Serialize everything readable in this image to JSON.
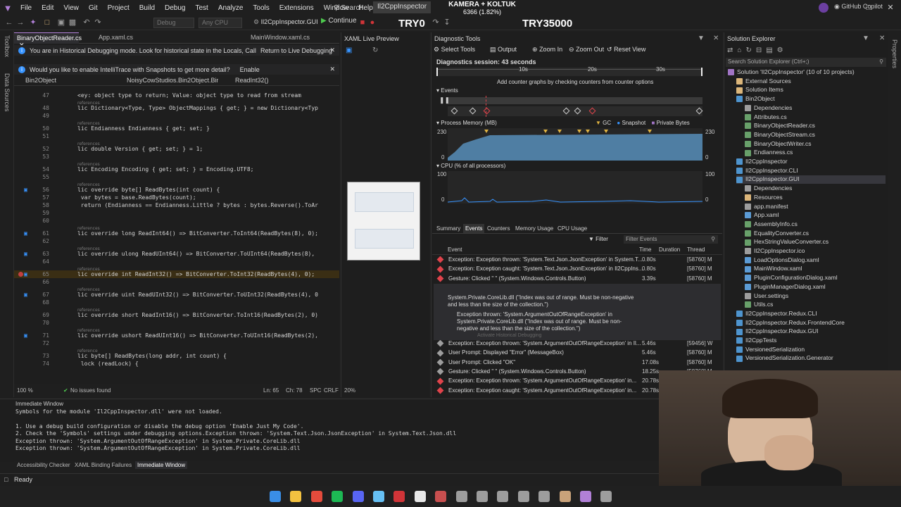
{
  "menu": {
    "items": [
      "File",
      "Edit",
      "View",
      "Git",
      "Project",
      "Build",
      "Debug",
      "Test",
      "Analyze",
      "Tools",
      "Extensions",
      "Window",
      "Help"
    ],
    "search": "Search",
    "app_name": "Il2CppInspector",
    "overlay_line1": "KAMERA + KOLTUK",
    "overlay_line2": "6366 (1.82%)",
    "github": "GitHub Copilot"
  },
  "toolbar": {
    "config": "Debug",
    "platform": "Any CPU",
    "startup": "Il2CppInspector.GUI",
    "continue": "Continue",
    "overlay_left": "TRY0",
    "overlay_right": "TRY35000"
  },
  "left_strip": [
    "Toolbox",
    "Data Sources"
  ],
  "editor": {
    "tabs": [
      "BinaryObjectReader.cs",
      "App.xaml.cs",
      "MainWindow.xaml.cs"
    ],
    "info1": "You are in Historical Debugging mode. Look for historical state in the Locals, Call Stack and other debugging windows.",
    "info1_link": "Return to Live Debugging",
    "info2": "Would you like to enable IntelliTrace with Snapshots to get more detail?",
    "info2_link": "Enable",
    "nav_project": "Bin2Object",
    "nav_class": "NoisyCowStudios.Bin2Object.Binar",
    "nav_member": "ReadInt32()",
    "lines": [
      {
        "ref": true,
        "text": ""
      },
      {
        "n": "47",
        "text": "<ey: object type to return; Value: object type to read from stream",
        "cls": "cm"
      },
      {
        "ref": true,
        "text": "references"
      },
      {
        "n": "48",
        "text": "lic Dictionary<Type, Type> ObjectMappings { get; } = new Dictionary<Typ"
      },
      {
        "n": "49",
        "text": ""
      },
      {
        "ref": true,
        "text": "references"
      },
      {
        "n": "50",
        "text": "lic Endianness Endianness { get; set; }"
      },
      {
        "n": "51",
        "text": ""
      },
      {
        "ref": true,
        "text": "references"
      },
      {
        "n": "52",
        "text": "lic double Version { get; set; } = 1;"
      },
      {
        "n": "53",
        "text": ""
      },
      {
        "ref": true,
        "text": "references"
      },
      {
        "n": "54",
        "text": "lic Encoding Encoding { get; set; } = Encoding.UTF8;"
      },
      {
        "n": "55",
        "text": ""
      },
      {
        "ref": true,
        "text": "references"
      },
      {
        "n": "56",
        "text": "lic override byte[] ReadBytes(int count) {"
      },
      {
        "n": "57",
        "text": " var bytes = base.ReadBytes(count);"
      },
      {
        "n": "58",
        "text": " return (Endianness == Endianness.Little ? bytes : bytes.Reverse().ToAr"
      },
      {
        "n": "59",
        "text": ""
      },
      {
        "n": "60",
        "text": ""
      },
      {
        "ref": true,
        "text": "references"
      },
      {
        "n": "61",
        "text": "lic override long ReadInt64() => BitConverter.ToInt64(ReadBytes(8), 0);"
      },
      {
        "n": "62",
        "text": ""
      },
      {
        "ref": true,
        "text": "references"
      },
      {
        "n": "63",
        "text": "lic override ulong ReadUInt64() => BitConverter.ToUInt64(ReadBytes(8),"
      },
      {
        "n": "64",
        "text": ""
      },
      {
        "ref": true,
        "text": "references"
      },
      {
        "n": "65",
        "text": "lic override int ReadInt32() => BitConverter.ToInt32(ReadBytes(4), 0);",
        "hl": true
      },
      {
        "n": "66",
        "text": ""
      },
      {
        "ref": true,
        "text": "references"
      },
      {
        "n": "67",
        "text": "lic override uint ReadUInt32() => BitConverter.ToUInt32(ReadBytes(4), 0"
      },
      {
        "n": "68",
        "text": ""
      },
      {
        "ref": true,
        "text": "references"
      },
      {
        "n": "69",
        "text": "lic override short ReadInt16() => BitConverter.ToInt16(ReadBytes(2), 0)"
      },
      {
        "n": "70",
        "text": ""
      },
      {
        "ref": true,
        "text": "references"
      },
      {
        "n": "71",
        "text": "lic override ushort ReadUInt16() => BitConverter.ToUInt16(ReadBytes(2),"
      },
      {
        "n": "72",
        "text": ""
      },
      {
        "ref": true,
        "text": "reference"
      },
      {
        "n": "73",
        "text": "lic byte[] ReadBytes(long addr, int count) {"
      },
      {
        "n": "74",
        "text": " lock (readLock) {"
      }
    ],
    "zoom": "100 %",
    "issues": "No issues found",
    "ln": "Ln: 65",
    "ch": "Ch: 78",
    "spc": "SPC",
    "crlf": "CRLF"
  },
  "xaml": {
    "title": "XAML Live Preview",
    "zoom": "20%"
  },
  "diag": {
    "title": "Diagnostic Tools",
    "select_tools": "Select Tools",
    "output": "Output",
    "zoom_in": "Zoom In",
    "zoom_out": "Zoom Out",
    "reset_view": "Reset View",
    "session": "Diagnostics session: 43 seconds",
    "ticks": [
      "10s",
      "20s",
      "30s"
    ],
    "add_counter": "Add counter graphs by checking counters from counter options",
    "events_label": "Events",
    "memory_label": "Process Memory (MB)",
    "gc": "GC",
    "snapshot": "Snapshot",
    "private_bytes": "Private Bytes",
    "mem_max": "230",
    "mem_min": "0",
    "cpu_label": "CPU (% of all processors)",
    "cpu_max": "100",
    "cpu_min": "0",
    "tabs": [
      "Summary",
      "Events",
      "Counters",
      "Memory Usage",
      "CPU Usage"
    ],
    "filter": "Filter",
    "filter_events": "Filter Events",
    "col_event": "Event",
    "col_time": "Time",
    "col_duration": "Duration",
    "col_thread": "Thread",
    "events": [
      {
        "text": "Exception: Exception thrown: 'System.Text.Json.JsonException' in System.T...",
        "time": "0.80s",
        "thread": "[58760] M",
        "color": "#e0434b"
      },
      {
        "text": "Exception: Exception caught: 'System.Text.Json.JsonException' in Il2CppIns...",
        "time": "0.80s",
        "thread": "[58760] M",
        "color": "#e0434b"
      },
      {
        "text": "Gesture: Clicked \"    \" (System.Windows.Controls.Button)",
        "time": "3.39s",
        "thread": "[58760] M",
        "color": "#e0434b"
      },
      {
        "text": "Exception: Exception thrown: 'System.ArgumentOutOfRangeException' in",
        "time": "5.46s",
        "thread": "[59456] W",
        "color": "#e0434b"
      }
    ],
    "selected_detail1": "System.Private.CoreLib.dll (\"Index was out of range. Must be non-negative",
    "selected_detail2": "and less than the size of the collection.\")",
    "detail_a": "Exception thrown: 'System.ArgumentOutOfRangeException' in",
    "detail_b": "System.Private.CoreLib.dll (\"Index was out of range. Must be non-",
    "detail_c": "negative and less than the size of the collection.\")",
    "detail_d": "Activate Historical Debugging",
    "events2": [
      {
        "text": "Exception: Exception thrown: 'System.ArgumentOutOfRangeException' in Il...",
        "time": "5.46s",
        "thread": "[59456] W",
        "color": "#9d9d9d"
      },
      {
        "text": "User Prompt: Displayed \"Error\" (MessageBox)",
        "time": "5.46s",
        "thread": "[58760] M",
        "color": "#9d9d9d"
      },
      {
        "text": "User Prompt: Clicked \"OK\"",
        "time": "17.08s",
        "thread": "[58760] M",
        "color": "#9d9d9d"
      },
      {
        "text": "Gesture: Clicked \"    \" (System.Windows.Controls.Button)",
        "time": "18.25s",
        "thread": "[58760] M",
        "color": "#9d9d9d"
      },
      {
        "text": "Exception: Exception thrown: 'System.ArgumentOutOfRangeException' in...",
        "time": "20.78s",
        "thread": "[58760] M",
        "color": "#e0434b"
      },
      {
        "text": "Exception: Exception caught: 'System.ArgumentOutOfRangeException' in...",
        "time": "20.78s",
        "thread": "[58760] M",
        "color": "#e0434b"
      }
    ]
  },
  "solution": {
    "title": "Solution Explorer",
    "search": "Search Solution Explorer (Ctrl+;)",
    "items": [
      {
        "label": "Solution 'Il2CppInspector' (10 of 10 projects)",
        "indent": 0,
        "color": "#a074c4"
      },
      {
        "label": "External Sources",
        "indent": 1,
        "color": "#dcb67a"
      },
      {
        "label": "Solution Items",
        "indent": 1,
        "color": "#dcb67a"
      },
      {
        "label": "Bin2Object",
        "indent": 1,
        "color": "#4e94ce"
      },
      {
        "label": "Dependencies",
        "indent": 2,
        "color": "#9d9d9d"
      },
      {
        "label": "Attributes.cs",
        "indent": 2,
        "color": "#68a06a"
      },
      {
        "label": "BinaryObjectReader.cs",
        "indent": 2,
        "color": "#68a06a"
      },
      {
        "label": "BinaryObjectStream.cs",
        "indent": 2,
        "color": "#68a06a"
      },
      {
        "label": "BinaryObjectWriter.cs",
        "indent": 2,
        "color": "#68a06a"
      },
      {
        "label": "Endianness.cs",
        "indent": 2,
        "color": "#68a06a"
      },
      {
        "label": "Il2CppInspector",
        "indent": 1,
        "color": "#4e94ce"
      },
      {
        "label": "Il2CppInspector.CLI",
        "indent": 1,
        "color": "#4e94ce"
      },
      {
        "label": "Il2CppInspector.GUI",
        "indent": 1,
        "color": "#4e94ce",
        "sel": true
      },
      {
        "label": "Dependencies",
        "indent": 2,
        "color": "#9d9d9d"
      },
      {
        "label": "Resources",
        "indent": 2,
        "color": "#dcb67a"
      },
      {
        "label": "app.manifest",
        "indent": 2,
        "color": "#9d9d9d"
      },
      {
        "label": "App.xaml",
        "indent": 2,
        "color": "#5b9bd5"
      },
      {
        "label": "AssemblyInfo.cs",
        "indent": 2,
        "color": "#68a06a"
      },
      {
        "label": "EqualityConverter.cs",
        "indent": 2,
        "color": "#68a06a"
      },
      {
        "label": "HexStringValueConverter.cs",
        "indent": 2,
        "color": "#68a06a"
      },
      {
        "label": "Il2CppInspector.ico",
        "indent": 2,
        "color": "#9d9d9d"
      },
      {
        "label": "LoadOptionsDialog.xaml",
        "indent": 2,
        "color": "#5b9bd5"
      },
      {
        "label": "MainWindow.xaml",
        "indent": 2,
        "color": "#5b9bd5"
      },
      {
        "label": "PluginConfigurationDialog.xaml",
        "indent": 2,
        "color": "#5b9bd5"
      },
      {
        "label": "PluginManagerDialog.xaml",
        "indent": 2,
        "color": "#5b9bd5"
      },
      {
        "label": "User.settings",
        "indent": 2,
        "color": "#9d9d9d"
      },
      {
        "label": "Utils.cs",
        "indent": 2,
        "color": "#68a06a"
      },
      {
        "label": "Il2CppInspector.Redux.CLI",
        "indent": 1,
        "color": "#4e94ce"
      },
      {
        "label": "Il2CppInspector.Redux.FrontendCore",
        "indent": 1,
        "color": "#4e94ce"
      },
      {
        "label": "Il2CppInspector.Redux.GUI",
        "indent": 1,
        "color": "#4e94ce"
      },
      {
        "label": "Il2CppTests",
        "indent": 1,
        "color": "#4e94ce"
      },
      {
        "label": "VersionedSerialization",
        "indent": 1,
        "color": "#4e94ce"
      },
      {
        "label": "VersionedSerialization.Generator",
        "indent": 1,
        "color": "#4e94ce"
      }
    ]
  },
  "immediate": {
    "title": "Immediate Window",
    "lines": [
      "Symbols for the module 'Il2CppInspector.dll' were not loaded.",
      "",
      "1. Use a debug build configuration or disable the debug option 'Enable Just My Code'.",
      "2. Check the 'Symbols' settings under debugging options.Exception thrown: 'System.Text.Json.JsonException' in System.Text.Json.dll",
      "Exception thrown: 'System.ArgumentOutOfRangeException' in System.Private.CoreLib.dll",
      "Exception thrown: 'System.ArgumentOutOfRangeException' in System.Private.CoreLib.dll"
    ],
    "tabs": [
      "Accessibility Checker",
      "XAML Binding Failures",
      "Immediate Window"
    ]
  },
  "status": {
    "ready": "Ready"
  },
  "taskbar": {
    "icons": [
      {
        "name": "windows-start-icon",
        "color": "#3a8ee6"
      },
      {
        "name": "file-explorer-icon",
        "color": "#f3c140"
      },
      {
        "name": "chrome-icon",
        "color": "#e54b3c"
      },
      {
        "name": "spotify-icon",
        "color": "#1db954"
      },
      {
        "name": "discord-icon",
        "color": "#5865f2"
      },
      {
        "name": "steam-icon",
        "color": "#66c0f4"
      },
      {
        "name": "obs-record-icon",
        "color": "#d13438"
      },
      {
        "name": "feather-app-icon",
        "color": "#e8e8e8"
      },
      {
        "name": "app-icon-1",
        "color": "#c94f4f"
      },
      {
        "name": "settings-gear-icon",
        "color": "#9d9d9d"
      },
      {
        "name": "calculator-icon",
        "color": "#9d9d9d"
      },
      {
        "name": "camera-icon",
        "color": "#9d9d9d"
      },
      {
        "name": "terminal-icon",
        "color": "#9d9d9d"
      },
      {
        "name": "app-icon-2",
        "color": "#9d9d9d"
      },
      {
        "name": "app-icon-3",
        "color": "#c9a27a"
      },
      {
        "name": "visual-studio-icon",
        "color": "#b180d7"
      },
      {
        "name": "app-icon-4",
        "color": "#9d9d9d"
      }
    ]
  }
}
